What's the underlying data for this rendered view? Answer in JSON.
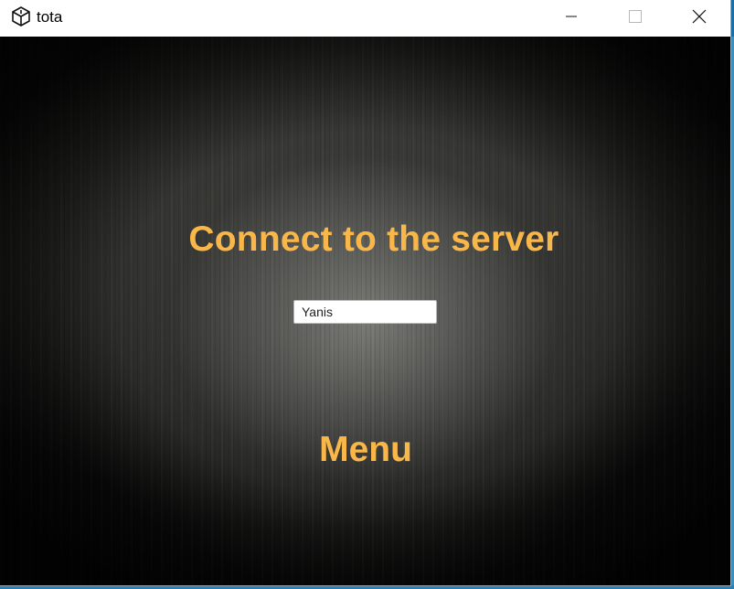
{
  "window": {
    "title": "tota",
    "icons": {
      "app": "unity-logo-icon",
      "minimize": "minimize-icon",
      "maximize": "maximize-icon",
      "close": "close-icon"
    }
  },
  "game": {
    "heading": "Connect to the server",
    "name_input": {
      "value": "Yanis",
      "placeholder": ""
    },
    "menu_button_label": "Menu"
  },
  "colors": {
    "accent_text": "#f9b74a",
    "background_dark": "#0c0c0c",
    "input_background": "#ffffff"
  }
}
